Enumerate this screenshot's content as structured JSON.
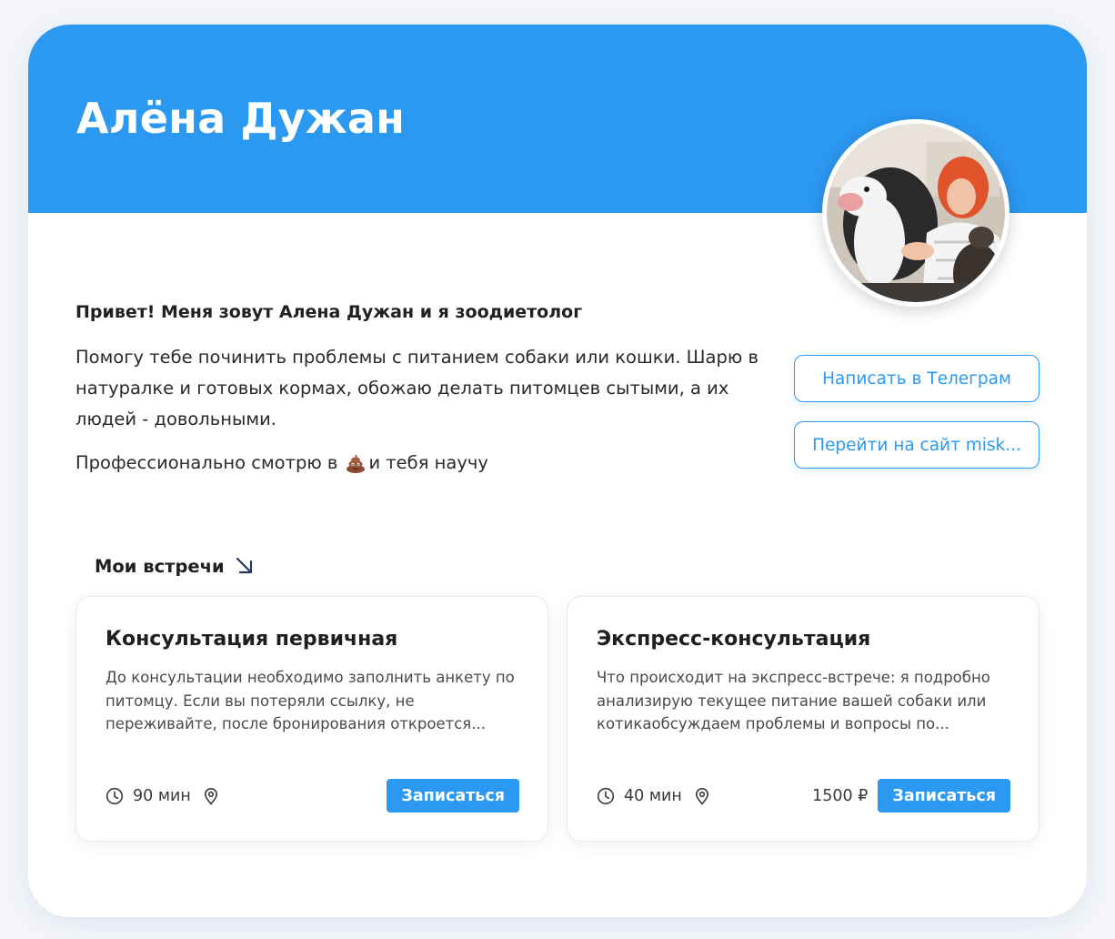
{
  "profile": {
    "name": "Алёна Дужан",
    "greeting": "Привет! Меня зовут Алена Дужан и я зоодиетолог",
    "bio": "Помогу тебе починить проблемы с питанием собаки или кошки. Шарю в натуралке и готовых кормах, обожаю делать питомцев сытыми, а их людей - довольными.",
    "bio2_before": "Профессионально смотрю в",
    "bio2_after": "и тебя научу",
    "avatar_icon": "profile-photo-woman-with-dog-and-cat"
  },
  "actions": {
    "telegram_label": "Написать в Телеграм",
    "site_label": "Перейти на сайт misk..."
  },
  "meetings": {
    "title": "Мои встречи",
    "items": [
      {
        "title": "Консультация первичная",
        "description": "До консультации необходимо заполнить анкету по питомцу. Если вы потеряли ссылку, не переживайте, после бронирования откроется...",
        "duration": "90 мин",
        "price": "",
        "button": "Записаться"
      },
      {
        "title": "Экспресс-консультация",
        "description": "Что происходит на экспресс-встрече: я подробно анализирую текущее питание вашей собаки или котикаобсуждаем проблемы и вопросы по...",
        "duration": "40 мин",
        "price": "1500 ₽",
        "button": "Записаться"
      }
    ]
  },
  "colors": {
    "accent": "#2b98f2",
    "background": "#f3f5fa",
    "card": "#ffffff"
  }
}
